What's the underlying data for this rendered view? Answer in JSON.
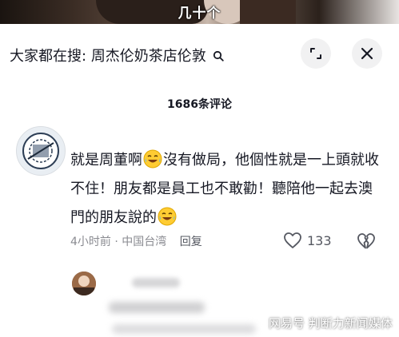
{
  "video": {
    "caption": "几十个"
  },
  "search": {
    "prefix": "大家都在搜:",
    "keyword": "周杰伦奶茶店伦敦"
  },
  "header": {
    "comment_count": "1686条评论"
  },
  "comment": {
    "text_part1": "就是周董啊",
    "text_part2": "沒有做局，他個性就是一上頭就收不住！朋友都是員工也不敢勸！聽陪他一起去澳門的朋友說的",
    "emoji": "laughing-tears-emoji",
    "time": "4小时前",
    "location": "中国台湾",
    "reply_label": "回复",
    "like_count": "133"
  },
  "watermark": "网易号 判断力新闻媒体",
  "colors": {
    "text": "#161823",
    "muted": "#8a8b91",
    "button_bg": "#f1f1f2"
  }
}
